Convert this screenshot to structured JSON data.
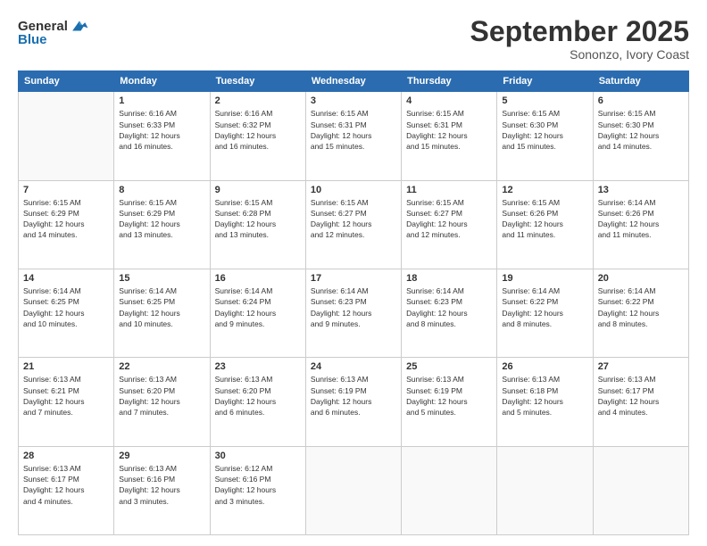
{
  "header": {
    "logo_general": "General",
    "logo_blue": "Blue",
    "month": "September 2025",
    "location": "Sononzo, Ivory Coast"
  },
  "days_of_week": [
    "Sunday",
    "Monday",
    "Tuesday",
    "Wednesday",
    "Thursday",
    "Friday",
    "Saturday"
  ],
  "weeks": [
    [
      {
        "day": "",
        "info": ""
      },
      {
        "day": "1",
        "info": "Sunrise: 6:16 AM\nSunset: 6:33 PM\nDaylight: 12 hours\nand 16 minutes."
      },
      {
        "day": "2",
        "info": "Sunrise: 6:16 AM\nSunset: 6:32 PM\nDaylight: 12 hours\nand 16 minutes."
      },
      {
        "day": "3",
        "info": "Sunrise: 6:15 AM\nSunset: 6:31 PM\nDaylight: 12 hours\nand 15 minutes."
      },
      {
        "day": "4",
        "info": "Sunrise: 6:15 AM\nSunset: 6:31 PM\nDaylight: 12 hours\nand 15 minutes."
      },
      {
        "day": "5",
        "info": "Sunrise: 6:15 AM\nSunset: 6:30 PM\nDaylight: 12 hours\nand 15 minutes."
      },
      {
        "day": "6",
        "info": "Sunrise: 6:15 AM\nSunset: 6:30 PM\nDaylight: 12 hours\nand 14 minutes."
      }
    ],
    [
      {
        "day": "7",
        "info": "Sunrise: 6:15 AM\nSunset: 6:29 PM\nDaylight: 12 hours\nand 14 minutes."
      },
      {
        "day": "8",
        "info": "Sunrise: 6:15 AM\nSunset: 6:29 PM\nDaylight: 12 hours\nand 13 minutes."
      },
      {
        "day": "9",
        "info": "Sunrise: 6:15 AM\nSunset: 6:28 PM\nDaylight: 12 hours\nand 13 minutes."
      },
      {
        "day": "10",
        "info": "Sunrise: 6:15 AM\nSunset: 6:27 PM\nDaylight: 12 hours\nand 12 minutes."
      },
      {
        "day": "11",
        "info": "Sunrise: 6:15 AM\nSunset: 6:27 PM\nDaylight: 12 hours\nand 12 minutes."
      },
      {
        "day": "12",
        "info": "Sunrise: 6:15 AM\nSunset: 6:26 PM\nDaylight: 12 hours\nand 11 minutes."
      },
      {
        "day": "13",
        "info": "Sunrise: 6:14 AM\nSunset: 6:26 PM\nDaylight: 12 hours\nand 11 minutes."
      }
    ],
    [
      {
        "day": "14",
        "info": "Sunrise: 6:14 AM\nSunset: 6:25 PM\nDaylight: 12 hours\nand 10 minutes."
      },
      {
        "day": "15",
        "info": "Sunrise: 6:14 AM\nSunset: 6:25 PM\nDaylight: 12 hours\nand 10 minutes."
      },
      {
        "day": "16",
        "info": "Sunrise: 6:14 AM\nSunset: 6:24 PM\nDaylight: 12 hours\nand 9 minutes."
      },
      {
        "day": "17",
        "info": "Sunrise: 6:14 AM\nSunset: 6:23 PM\nDaylight: 12 hours\nand 9 minutes."
      },
      {
        "day": "18",
        "info": "Sunrise: 6:14 AM\nSunset: 6:23 PM\nDaylight: 12 hours\nand 8 minutes."
      },
      {
        "day": "19",
        "info": "Sunrise: 6:14 AM\nSunset: 6:22 PM\nDaylight: 12 hours\nand 8 minutes."
      },
      {
        "day": "20",
        "info": "Sunrise: 6:14 AM\nSunset: 6:22 PM\nDaylight: 12 hours\nand 8 minutes."
      }
    ],
    [
      {
        "day": "21",
        "info": "Sunrise: 6:13 AM\nSunset: 6:21 PM\nDaylight: 12 hours\nand 7 minutes."
      },
      {
        "day": "22",
        "info": "Sunrise: 6:13 AM\nSunset: 6:20 PM\nDaylight: 12 hours\nand 7 minutes."
      },
      {
        "day": "23",
        "info": "Sunrise: 6:13 AM\nSunset: 6:20 PM\nDaylight: 12 hours\nand 6 minutes."
      },
      {
        "day": "24",
        "info": "Sunrise: 6:13 AM\nSunset: 6:19 PM\nDaylight: 12 hours\nand 6 minutes."
      },
      {
        "day": "25",
        "info": "Sunrise: 6:13 AM\nSunset: 6:19 PM\nDaylight: 12 hours\nand 5 minutes."
      },
      {
        "day": "26",
        "info": "Sunrise: 6:13 AM\nSunset: 6:18 PM\nDaylight: 12 hours\nand 5 minutes."
      },
      {
        "day": "27",
        "info": "Sunrise: 6:13 AM\nSunset: 6:17 PM\nDaylight: 12 hours\nand 4 minutes."
      }
    ],
    [
      {
        "day": "28",
        "info": "Sunrise: 6:13 AM\nSunset: 6:17 PM\nDaylight: 12 hours\nand 4 minutes."
      },
      {
        "day": "29",
        "info": "Sunrise: 6:13 AM\nSunset: 6:16 PM\nDaylight: 12 hours\nand 3 minutes."
      },
      {
        "day": "30",
        "info": "Sunrise: 6:12 AM\nSunset: 6:16 PM\nDaylight: 12 hours\nand 3 minutes."
      },
      {
        "day": "",
        "info": ""
      },
      {
        "day": "",
        "info": ""
      },
      {
        "day": "",
        "info": ""
      },
      {
        "day": "",
        "info": ""
      }
    ]
  ]
}
